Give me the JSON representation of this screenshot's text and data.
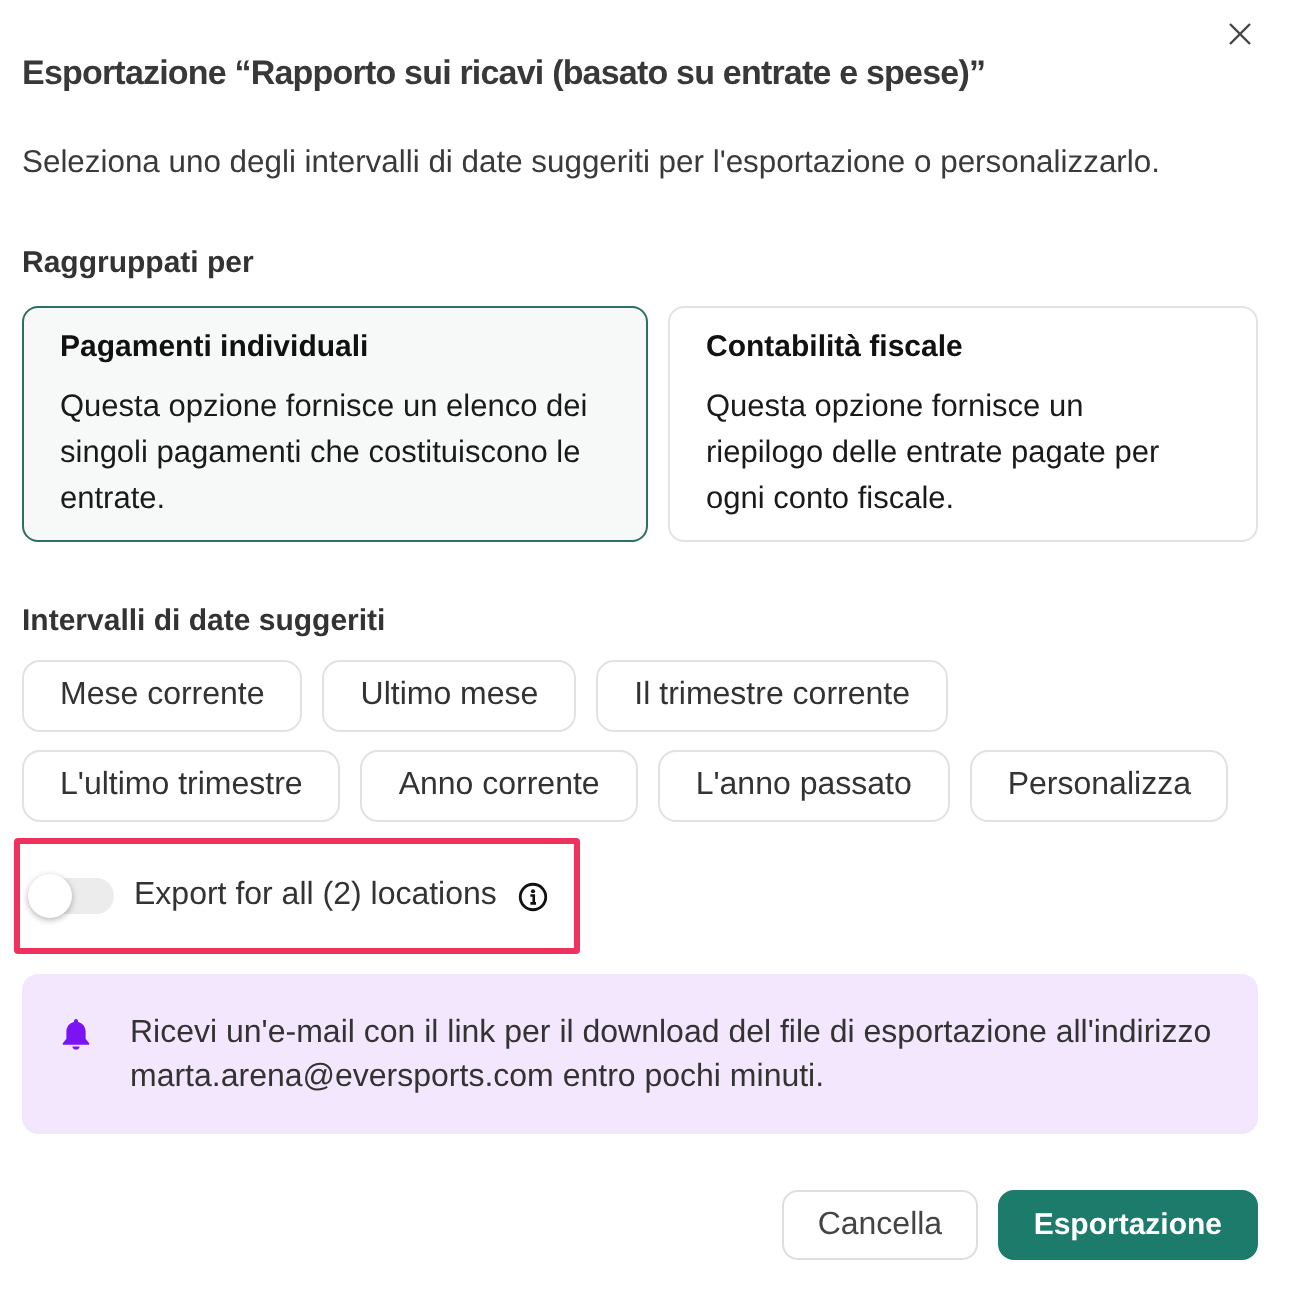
{
  "dialog": {
    "title": "Esportazione “Rapporto sui ricavi (basato su entrate e spese)”",
    "description": "Seleziona uno degli intervalli di date suggeriti per l'esportazione o personalizzarlo."
  },
  "grouping": {
    "label": "Raggruppati per",
    "options": [
      {
        "title": "Pagamenti individuali",
        "description": "Questa opzione fornisce un elenco dei singoli pagamenti che costituiscono le entrate.",
        "selected": true
      },
      {
        "title": "Contabilità fiscale",
        "description": "Questa opzione fornisce un riepilogo delle entrate pagate per ogni conto fiscale.",
        "selected": false
      }
    ]
  },
  "date_ranges": {
    "label": "Intervalli di date suggeriti",
    "chips": [
      {
        "label": "Mese corrente",
        "selected": false
      },
      {
        "label": "Ultimo mese",
        "selected": false
      },
      {
        "label": "Il trimestre corrente",
        "selected": false
      },
      {
        "label": "L'ultimo trimestre",
        "selected": false
      },
      {
        "label": "Anno corrente",
        "selected": false
      },
      {
        "label": "L'anno passato",
        "selected": false
      },
      {
        "label": "Personalizza",
        "selected": false
      }
    ]
  },
  "locations_toggle": {
    "label": "Export for all (2) locations",
    "on": false,
    "highlighted": true
  },
  "notice": {
    "text": "Ricevi un'e-mail con il link per il download del file di esportazione all'indirizzo marta.arena@eversports.com entro pochi minuti."
  },
  "buttons": [
    {
      "label": "Cancella",
      "kind": "secondary"
    },
    {
      "label": "Esportazione",
      "kind": "primary"
    }
  ]
}
